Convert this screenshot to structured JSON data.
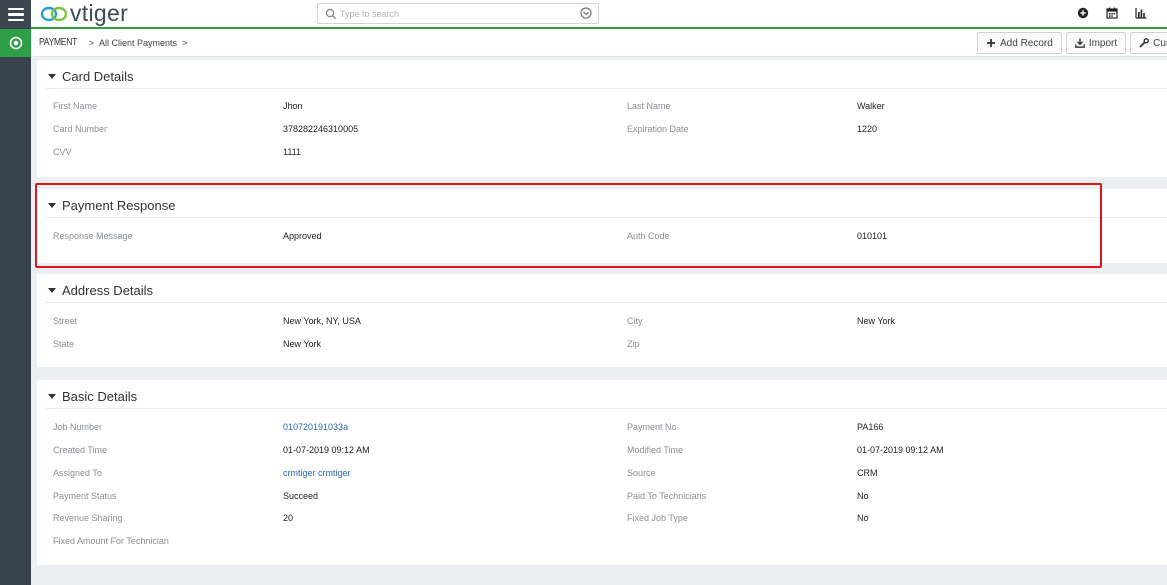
{
  "app": {
    "logo_text": "vtiger"
  },
  "search": {
    "placeholder": "Type to search"
  },
  "breadcrumb": {
    "module": "PAYMENT",
    "sep1": ">",
    "view": "All Client Payments",
    "sep2": ">"
  },
  "actions": {
    "add_record": "Add Record",
    "import": "Import",
    "customize": "Custo"
  },
  "sections": {
    "card": {
      "title": "Card Details",
      "first_name_label": "First Name",
      "first_name": "Jhon",
      "last_name_label": "Last Name",
      "last_name": "Walker",
      "card_number_label": "Card Number",
      "card_number": "378282246310005",
      "expiration_label": "Expiration Date",
      "expiration": "1220",
      "cvv_label": "CVV",
      "cvv": "1111"
    },
    "response": {
      "title": "Payment Response",
      "message_label": "Response Message",
      "message": "Approved",
      "auth_label": "Auth Code",
      "auth": "010101"
    },
    "address": {
      "title": "Address Details",
      "street_label": "Street",
      "street": "New York, NY, USA",
      "city_label": "City",
      "city": "New York",
      "state_label": "State",
      "state": "New York",
      "zip_label": "Zip",
      "zip": ""
    },
    "basic": {
      "title": "Basic Details",
      "job_number_label": "Job Number",
      "job_number": "010720191033a",
      "payment_no_label": "Payment No",
      "payment_no": "PA166",
      "created_label": "Created Time",
      "created": "01-07-2019 09:12 AM",
      "modified_label": "Modified Time",
      "modified": "01-07-2019 09:12 AM",
      "assigned_label": "Assigned To",
      "assigned": "crmtiger crmtiger",
      "source_label": "Source",
      "source": "CRM",
      "status_label": "Payment Status",
      "status": "Succeed",
      "paid_label": "Paid To Technicians",
      "paid": "No",
      "revenue_label": "Revenue Sharing",
      "revenue": "20",
      "fixed_type_label": "Fixed Job Type",
      "fixed_type": "No",
      "fixed_amount_label": "Fixed Amount For Technician",
      "fixed_amount": ""
    }
  },
  "colors": {
    "accent_green": "#2e9f47",
    "highlight_red": "#e0161b",
    "link_blue": "#2767b3"
  }
}
